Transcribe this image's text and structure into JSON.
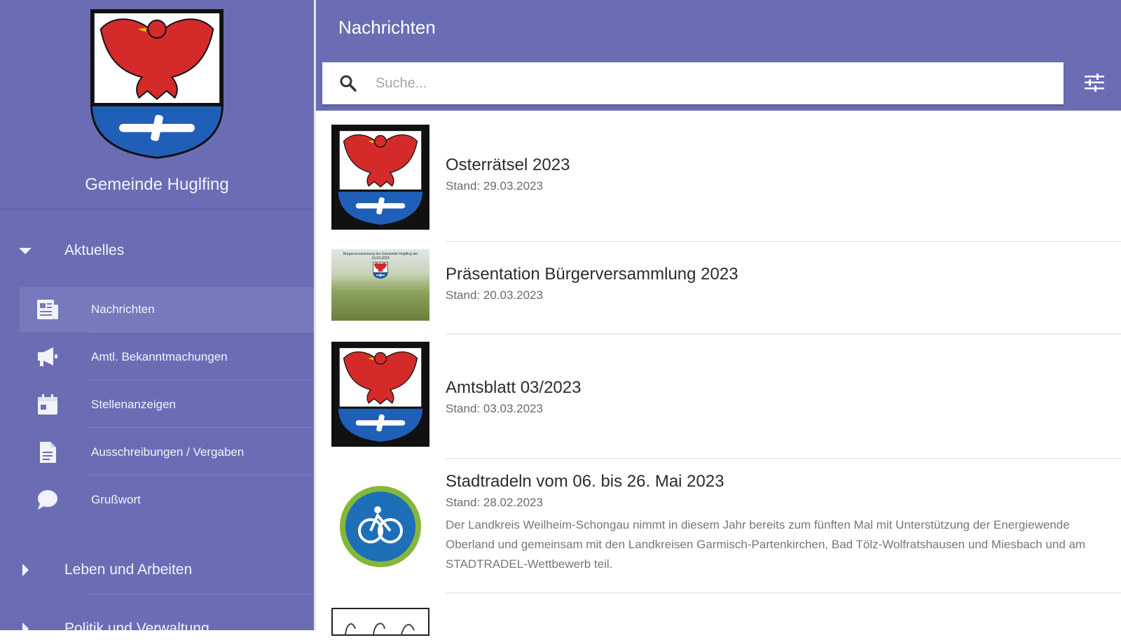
{
  "sidebar": {
    "municipality": "Gemeinde Huglfing",
    "groups": [
      {
        "label": "Aktuelles",
        "expanded": true
      },
      {
        "label": "Leben und Arbeiten",
        "expanded": false
      },
      {
        "label": "Politik und Verwaltung",
        "expanded": false
      }
    ],
    "items": [
      {
        "label": "Nachrichten",
        "icon": "newspaper-icon",
        "active": true
      },
      {
        "label": "Amtl. Bekanntmachungen",
        "icon": "megaphone-icon"
      },
      {
        "label": "Stellenanzeigen",
        "icon": "calendar-icon"
      },
      {
        "label": "Ausschreibungen / Vergaben",
        "icon": "document-icon"
      },
      {
        "label": "Grußwort",
        "icon": "chat-bubble-icon"
      }
    ]
  },
  "header": {
    "title": "Nachrichten",
    "search_placeholder": "Suche...",
    "search_value": "",
    "filter_icon": "filter-sliders-icon"
  },
  "news": [
    {
      "title": "Osterrätsel 2023",
      "date": "Stand: 29.03.2023",
      "description": "",
      "thumb": "crest"
    },
    {
      "title": "Präsentation Bürgerversammlung 2023",
      "date": "Stand: 20.03.2023",
      "description": "",
      "thumb": "presentation",
      "thumb_caption": "Bürgerversammlung der Gemeinde Huglfing am 16.03.2023"
    },
    {
      "title": "Amtsblatt 03/2023",
      "date": "Stand: 03.03.2023",
      "description": "",
      "thumb": "crest"
    },
    {
      "title": "Stadtradeln vom 06. bis 26. Mai 2023",
      "date": "Stand: 28.02.2023",
      "description": "Der Landkreis Weilheim-Schongau nimmt in diesem Jahr bereits zum fünften Mal mit Unterstützung der Energiewende Oberland und gemeinsam mit den Landkreisen Garmisch-Partenkirchen, Bad Tölz-Wolfratshausen und Miesbach und am STADTRADEL-Wettbewerb teil.",
      "thumb": "stadtradeln"
    }
  ],
  "colors": {
    "primary": "#6b6db4",
    "primary_active": "#7779bd",
    "crest_red": "#d42a2a",
    "crest_blue": "#1f5fb8"
  }
}
